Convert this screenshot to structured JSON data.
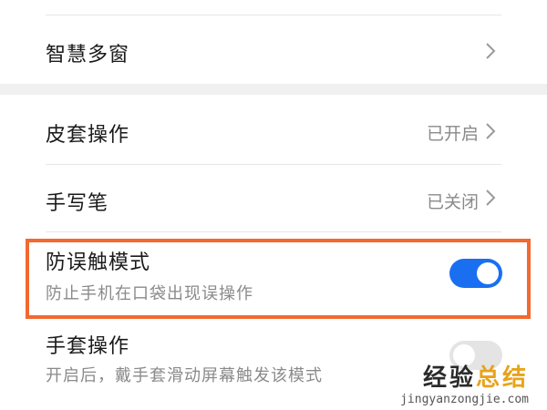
{
  "settings": {
    "top_item": {
      "label": "智慧多窗"
    },
    "items": [
      {
        "label": "皮套操作",
        "status": "已开启",
        "control": "chevron-right-icon"
      },
      {
        "label": "手写笔",
        "status": "已关闭",
        "control": "chevron-right-icon"
      },
      {
        "label": "防误触模式",
        "description": "防止手机在口袋出现误操作",
        "toggle_on": true,
        "highlighted": true
      },
      {
        "label": "手套操作",
        "description": "开启后，戴手套滑动屏幕触发该模式",
        "toggle_on": false
      }
    ]
  },
  "watermark": {
    "text_part1": "经验",
    "text_part2": "总结",
    "url": "jingyanzongjie.com"
  },
  "colors": {
    "toggle_on": "#1a6ff0",
    "toggle_off": "#e4e4e4",
    "highlight_border": "#f2692f",
    "secondary_text": "#8a8a8a"
  }
}
